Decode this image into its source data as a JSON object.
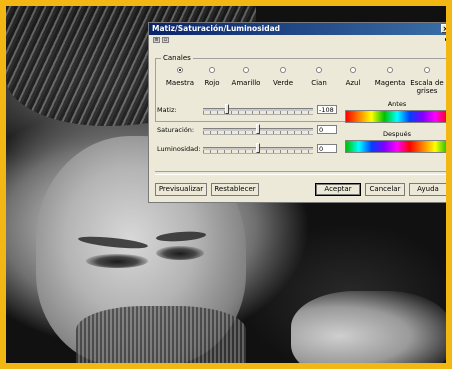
{
  "dialog": {
    "title": "Matiz/Saturación/Luminosidad",
    "close_label": "×",
    "toolbar_icons": [
      "grid-icon",
      "panel-icon"
    ],
    "toolbar_arrow": "▸"
  },
  "channels": {
    "legend": "Canales",
    "items": [
      {
        "label": "Maestra",
        "selected": true
      },
      {
        "label": "Rojo",
        "selected": false
      },
      {
        "label": "Amarillo",
        "selected": false
      },
      {
        "label": "Verde",
        "selected": false
      },
      {
        "label": "Cian",
        "selected": false
      },
      {
        "label": "Azul",
        "selected": false
      },
      {
        "label": "Magenta",
        "selected": false
      },
      {
        "label": "Escala de grises",
        "selected": false
      }
    ]
  },
  "adjustments": {
    "hue": {
      "label": "Matiz:",
      "value": "-108"
    },
    "saturation": {
      "label": "Saturación:",
      "value": "0"
    },
    "luminosity": {
      "label": "Luminosidad:",
      "value": "0"
    }
  },
  "preview": {
    "before_label": "Antes",
    "after_label": "Después"
  },
  "buttons": {
    "preview": "Previsualizar",
    "reset": "Restablecer",
    "accept": "Aceptar",
    "cancel": "Cancelar",
    "help": "Ayuda"
  },
  "colors": {
    "frame": "#f2b712",
    "dialog_bg": "#ece9d8",
    "titlebar": "#0a246a"
  }
}
